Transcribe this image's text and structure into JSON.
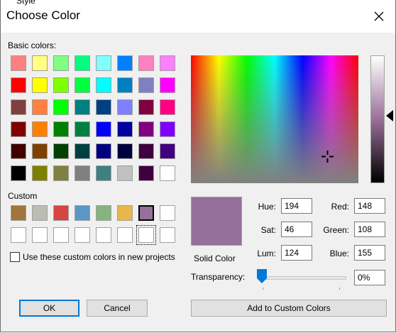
{
  "window": {
    "peek_text": "Style",
    "title": "Choose Color",
    "close_icon": "close-icon"
  },
  "basic": {
    "label": "Basic colors:",
    "colors": [
      "#ff8080",
      "#ffff80",
      "#80ff80",
      "#00ff80",
      "#80ffff",
      "#0080ff",
      "#ff80c0",
      "#ff80ff",
      "#ff0000",
      "#ffff00",
      "#80ff00",
      "#00ff40",
      "#00ffff",
      "#0080c0",
      "#8080c0",
      "#ff00ff",
      "#804040",
      "#ff8040",
      "#00ff00",
      "#008080",
      "#004080",
      "#8080ff",
      "#800040",
      "#ff0080",
      "#800000",
      "#ff8000",
      "#008000",
      "#008040",
      "#0000ff",
      "#0000a0",
      "#800080",
      "#8000ff",
      "#400000",
      "#804000",
      "#004000",
      "#004040",
      "#000080",
      "#000040",
      "#400040",
      "#400080",
      "#000000",
      "#808000",
      "#808040",
      "#808080",
      "#408080",
      "#c0c0c0",
      "#400040",
      "#ffffff"
    ]
  },
  "custom": {
    "label": "Custom",
    "colors": [
      "#a0763a",
      "#bcbcb4",
      "#d64541",
      "#5b96c7",
      "#85b47c",
      "#e8b74a",
      "#94709b",
      "#ffffff",
      "#ffffff",
      "#ffffff",
      "#ffffff",
      "#ffffff",
      "#ffffff",
      "#ffffff",
      "#ffffff",
      "#ffffff"
    ],
    "checkbox_label": "Use these custom colors in new projects"
  },
  "preview": {
    "color": "#94709b",
    "label": "Solid Color"
  },
  "fields": {
    "hue_label": "Hue:",
    "hue": "194",
    "sat_label": "Sat:",
    "sat": "46",
    "lum_label": "Lum:",
    "lum": "124",
    "red_label": "Red:",
    "red": "148",
    "green_label": "Green:",
    "green": "108",
    "blue_label": "Blue:",
    "blue": "155"
  },
  "transparency": {
    "label": "Transparency:",
    "value": "0%",
    "level": 0
  },
  "buttons": {
    "ok": "OK",
    "cancel": "Cancel",
    "add_custom": "Add to Custom Colors"
  }
}
